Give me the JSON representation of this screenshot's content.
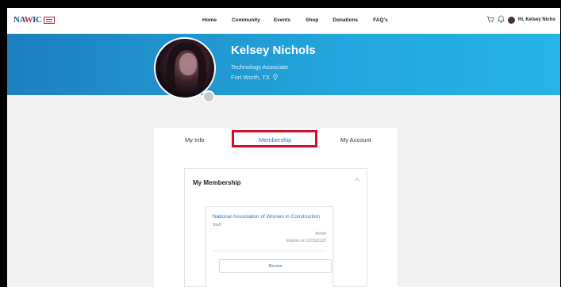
{
  "nav": {
    "logo_text_1": "NA",
    "logo_text_w": "W",
    "logo_text_2": "IC",
    "links": [
      "Home",
      "Community",
      "Events",
      "Shop",
      "Donations",
      "FAQ's"
    ],
    "greeting": "Hi, Kelsey Nicho"
  },
  "profile": {
    "name": "Kelsey Nichols",
    "title": "Technology Associate",
    "location": "Fort Worth, TX",
    "location_icon": "map-pin-icon"
  },
  "tabs": {
    "info": "My Info",
    "membership": "Membership",
    "account": "My Account"
  },
  "membership": {
    "header": "My Membership",
    "organization": "National Association of Women in Construction",
    "role": "Staff",
    "status": "Active",
    "expires": "Expires on 12/31/2123",
    "renew_label": "Renew"
  },
  "colors": {
    "accent": "#1f78c4",
    "banner_start": "#1d80bf",
    "banner_end": "#27b4e6",
    "highlight": "#d3102a"
  }
}
